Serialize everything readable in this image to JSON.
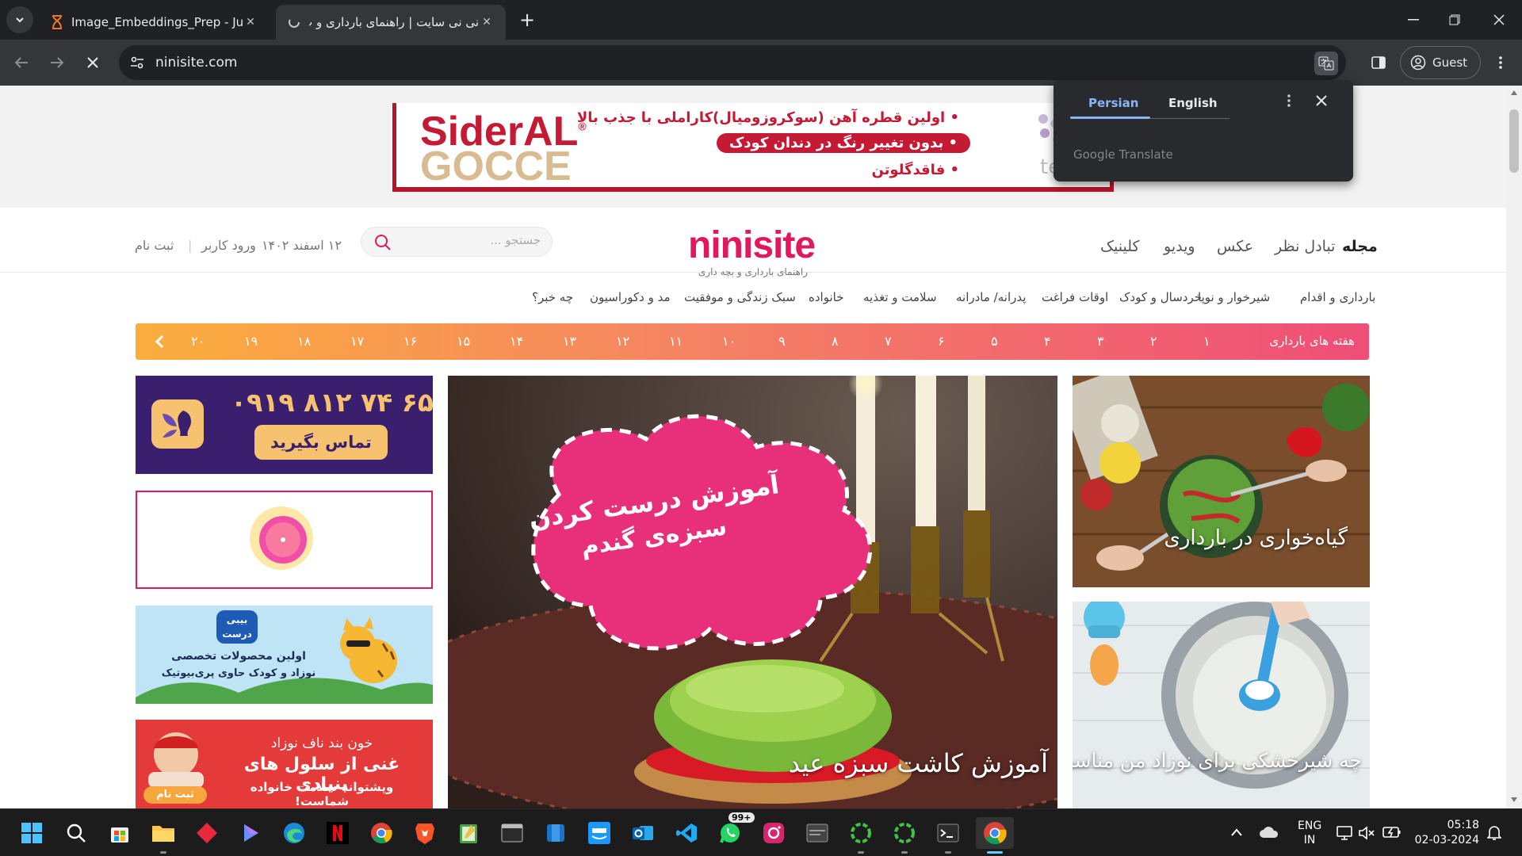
{
  "browser": {
    "tabs": [
      {
        "title": "Image_Embeddings_Prep - Jupy",
        "active": false
      },
      {
        "title": "نی نی سایت | راهنمای بارداری و ب",
        "active": true
      }
    ],
    "url": "ninisite.com",
    "profile": "Guest"
  },
  "translate_popup": {
    "source_lang": "Persian",
    "target_lang": "English",
    "brand": "Google Translate"
  },
  "ad_banner": {
    "brand_line1": "SiderAL",
    "brand_line1_mark": "®",
    "brand_line2": "GOCCE",
    "bullets": [
      "• اولین قطره آهن (سوکروزومیال)کاراملی با جذب بالا",
      "• بدون تغییر رنگ در دندان کودک",
      "• فاقدگلوتن"
    ],
    "edge_text": "te"
  },
  "site": {
    "logo": "ninisite",
    "logo_tagline": "راهنمای بارداری و بچه داری",
    "main_nav": [
      "مجله",
      "تبادل نظر",
      "عکس",
      "ویدیو",
      "کلینیک"
    ],
    "search_placeholder": "جستجو ...",
    "date": "۱۲ اسفند ۱۴۰۲",
    "login": "ورود کاربر",
    "separator": "|",
    "signup": "ثبت نام",
    "categories": [
      "بارداری و اقدام",
      "شیرخوار و نوپا",
      "خردسال و کودک",
      "اوقات فراغت",
      "پدرانه/ مادرانه",
      "سلامت و تغذیه",
      "خانواده",
      "سبک زندگی و موفقیت",
      "مد و دکوراسیون",
      "چه خبر؟"
    ],
    "weeks_label": "هفته های بارداری",
    "weeks": [
      "۱",
      "۲",
      "۳",
      "۴",
      "۵",
      "۶",
      "۷",
      "۸",
      "۹",
      "۱۰",
      "۱۱",
      "۱۲",
      "۱۳",
      "۱۴",
      "۱۵",
      "۱۶",
      "۱۷",
      "۱۸",
      "۱۹",
      "۲۰"
    ]
  },
  "side_ads": {
    "phone": "۰۹۱۹ ۸۱۲ ۷۴ ۶۵",
    "call_label": "تماس بگیرید",
    "babyderm_logo_top": "بیبی",
    "babyderm_logo_bottom": "درست",
    "babyderm_line1": "اولین محصولات تخصصی",
    "babyderm_line2": "نوزاد و کودک حاوی پری‌بیوتیک",
    "cord_line1": "خون بند ناف نوزاد",
    "cord_line2": "غنی از سلول های بنیادی",
    "cord_line3": "وپشتوانه سلامت خانواده شماست!",
    "cord_btn": "ثبت نام"
  },
  "hero": {
    "bubble_line1": "آموزش درست کردن",
    "bubble_line2": "سبزه‌ی گندم",
    "caption": "آموزش کاشت سبزه عید"
  },
  "cards": [
    {
      "caption": "گیاه‌خواری در بارداری"
    },
    {
      "caption": "چه شیرخشکی برای نوزاد من مناسبه؟"
    }
  ],
  "taskbar": {
    "whatsapp_badge": "99+",
    "lang_line1": "ENG",
    "lang_line2": "IN",
    "time": "05:18",
    "date": "02-03-2024"
  }
}
